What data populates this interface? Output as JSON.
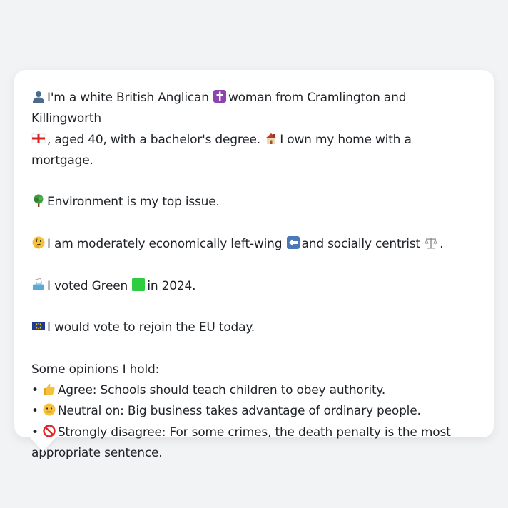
{
  "profile": {
    "intro_line_1": "I'm a white British Anglican",
    "intro_line_1b": "woman from Cramlington and Killingworth",
    "intro_line_2": ", aged 40, with a bachelor's degree.",
    "intro_line_2b": "I own my home with a mortgage.",
    "top_issue": "Environment is my top issue.",
    "ideology_a": "I am moderately economically left-wing",
    "ideology_b": "and socially centrist",
    "ideology_c": ".",
    "vote_a": "I voted Green",
    "vote_b": "in 2024.",
    "eu": "I would vote to rejoin the EU today."
  },
  "opinions": {
    "heading": "Some opinions I hold:",
    "bullet": "•",
    "items": [
      {
        "icon": "thumbs-up-icon",
        "text": "Agree: Schools should teach children to obey authority."
      },
      {
        "icon": "neutral-face-icon",
        "text": "Neutral on: Big business takes advantage of ordinary people."
      },
      {
        "icon": "prohibited-icon",
        "text": "Strongly disagree: For some crimes, the death penalty is the most",
        "text_cont": "appropriate sentence."
      }
    ]
  },
  "colors": {
    "background": "#f2f3f5",
    "bubble": "#ffffff",
    "text": "#1f2328"
  }
}
